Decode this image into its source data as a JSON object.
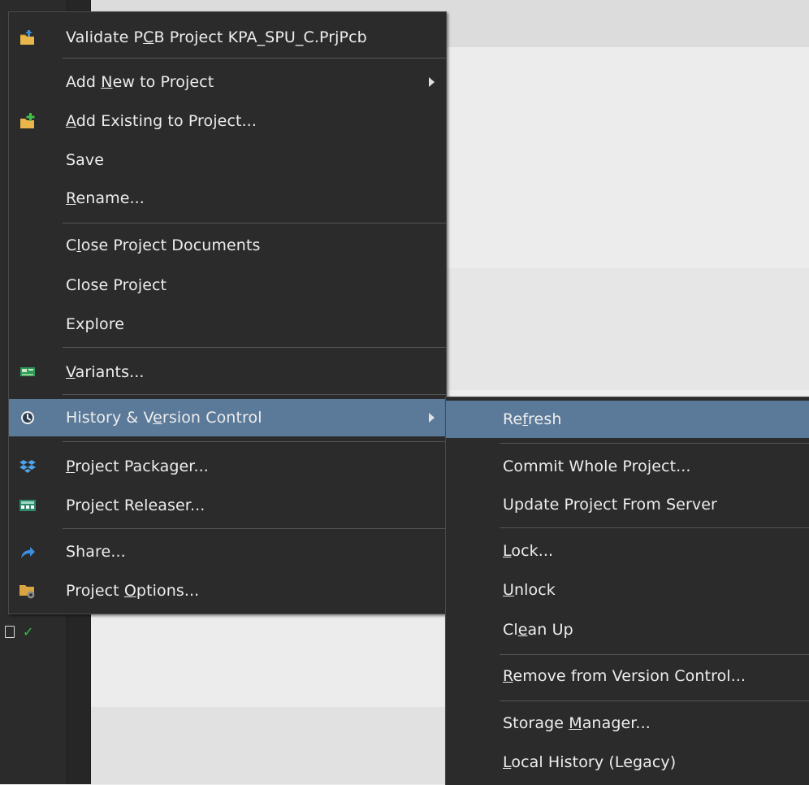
{
  "main_menu": {
    "validate": {
      "pre": "Validate P",
      "u": "C",
      "post": "B Project KPA_SPU_C.PrjPcb"
    },
    "add_new": {
      "pre": "Add ",
      "u": "N",
      "post": "ew to Project"
    },
    "add_existing": {
      "pre": "",
      "u": "A",
      "post": "dd Existing to Project..."
    },
    "save": {
      "pre": "Save",
      "u": "",
      "post": ""
    },
    "rename": {
      "pre": "",
      "u": "R",
      "post": "ename..."
    },
    "close_docs": {
      "pre": "C",
      "u": "l",
      "post": "ose Project Documents"
    },
    "close_project": {
      "pre": "Close Project",
      "u": "",
      "post": ""
    },
    "explore": {
      "pre": "Explore",
      "u": "",
      "post": ""
    },
    "variants": {
      "pre": "",
      "u": "V",
      "post": "ariants..."
    },
    "history": {
      "pre": "History & V",
      "u": "e",
      "post": "rsion Control"
    },
    "packager": {
      "pre": "",
      "u": "P",
      "post": "roject Packager..."
    },
    "releaser": {
      "pre": "Project Releaser...",
      "u": "",
      "post": ""
    },
    "share": {
      "pre": "Share...",
      "u": "",
      "post": ""
    },
    "options": {
      "pre": "Project ",
      "u": "O",
      "post": "ptions..."
    }
  },
  "sub_menu": {
    "refresh": {
      "pre": "Re",
      "u": "f",
      "post": "resh"
    },
    "commit": {
      "pre": "Commit Whole Project...",
      "u": "",
      "post": ""
    },
    "update": {
      "pre": "Update Project From Server",
      "u": "",
      "post": ""
    },
    "lock": {
      "pre": "",
      "u": "L",
      "post": "ock..."
    },
    "unlock": {
      "pre": "",
      "u": "U",
      "post": "nlock"
    },
    "cleanup": {
      "pre": "Cl",
      "u": "e",
      "post": "an Up"
    },
    "remove": {
      "pre": "",
      "u": "R",
      "post": "emove from Version Control..."
    },
    "storage": {
      "pre": "Storage ",
      "u": "M",
      "post": "anager..."
    },
    "local_history": {
      "pre": "",
      "u": "L",
      "post": "ocal History (Legacy)"
    }
  },
  "icons": {
    "validate": "validate-project-icon",
    "add_existing": "add-existing-icon",
    "variants": "variants-icon",
    "history": "clock-icon",
    "packager": "packager-icon",
    "releaser": "releaser-icon",
    "share": "share-arrow-icon",
    "options": "project-options-icon"
  },
  "colors": {
    "menu_bg": "#2b2b2b",
    "highlight": "#5b7a99",
    "text": "#ededed"
  }
}
